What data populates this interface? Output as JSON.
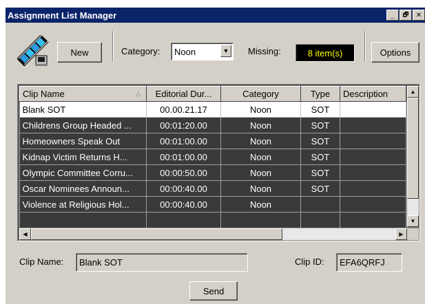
{
  "window": {
    "title": "Assignment List Manager",
    "minimize": "_",
    "maximize": "🗗",
    "close": "✕"
  },
  "toolbar": {
    "new_label": "New",
    "category_label": "Category:",
    "category_value": "Noon",
    "missing_label": "Missing:",
    "missing_value": "8 item(s)",
    "options_label": "Options"
  },
  "grid": {
    "columns": [
      "Clip Name",
      "Editorial Dur...",
      "Category",
      "Type",
      "Description"
    ],
    "rows": [
      {
        "name": "Blank SOT",
        "duration": "00.00.21.17",
        "category": "Noon",
        "type": "SOT",
        "description": ""
      },
      {
        "name": "Childrens Group Headed ...",
        "duration": "00:01:20.00",
        "category": "Noon",
        "type": "SOT",
        "description": ""
      },
      {
        "name": "Homeowners Speak Out",
        "duration": "00:01:00.00",
        "category": "Noon",
        "type": "SOT",
        "description": ""
      },
      {
        "name": "Kidnap Victim Returns H...",
        "duration": "00:01:00.00",
        "category": "Noon",
        "type": "SOT",
        "description": ""
      },
      {
        "name": "Olympic Committee Corru...",
        "duration": "00:00:50.00",
        "category": "Noon",
        "type": "SOT",
        "description": ""
      },
      {
        "name": "Oscar Nominees Announ...",
        "duration": "00:00:40.00",
        "category": "Noon",
        "type": "SOT",
        "description": ""
      },
      {
        "name": "Violence at Religious Hol...",
        "duration": "00:00:40.00",
        "category": "Noon",
        "type": "",
        "description": ""
      }
    ]
  },
  "details": {
    "clip_name_label": "Clip Name:",
    "clip_name_value": "Blank SOT",
    "clip_id_label": "Clip ID:",
    "clip_id_value": "EFA6QRFJ"
  },
  "send_label": "Send",
  "colors": {
    "title_bar": "#0a246a",
    "missing_bg": "#000000",
    "missing_fg": "#ffff00",
    "row_bg": "#3a3a3a"
  }
}
